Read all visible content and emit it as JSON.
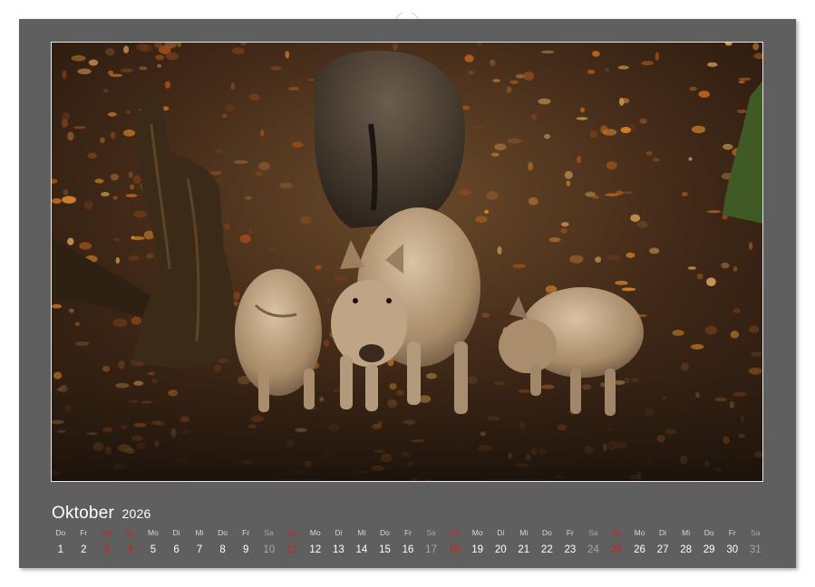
{
  "calendar": {
    "month": "Oktober",
    "year": "2026",
    "sunday_color": "#d0221f",
    "saturday_color": "#a7a7a7",
    "days": [
      {
        "dow": "Do",
        "num": "1",
        "type": "weekday"
      },
      {
        "dow": "Fr",
        "num": "2",
        "type": "weekday"
      },
      {
        "dow": "Sa",
        "num": "3",
        "type": "sunday"
      },
      {
        "dow": "So",
        "num": "4",
        "type": "sunday"
      },
      {
        "dow": "Mo",
        "num": "5",
        "type": "weekday"
      },
      {
        "dow": "Di",
        "num": "6",
        "type": "weekday"
      },
      {
        "dow": "Mi",
        "num": "7",
        "type": "weekday"
      },
      {
        "dow": "Do",
        "num": "8",
        "type": "weekday"
      },
      {
        "dow": "Fr",
        "num": "9",
        "type": "weekday"
      },
      {
        "dow": "Sa",
        "num": "10",
        "type": "saturday"
      },
      {
        "dow": "So",
        "num": "11",
        "type": "sunday"
      },
      {
        "dow": "Mo",
        "num": "12",
        "type": "weekday"
      },
      {
        "dow": "Di",
        "num": "13",
        "type": "weekday"
      },
      {
        "dow": "Mi",
        "num": "14",
        "type": "weekday"
      },
      {
        "dow": "Do",
        "num": "15",
        "type": "weekday"
      },
      {
        "dow": "Fr",
        "num": "16",
        "type": "weekday"
      },
      {
        "dow": "Sa",
        "num": "17",
        "type": "saturday"
      },
      {
        "dow": "So",
        "num": "18",
        "type": "sunday"
      },
      {
        "dow": "Mo",
        "num": "19",
        "type": "weekday"
      },
      {
        "dow": "Di",
        "num": "20",
        "type": "weekday"
      },
      {
        "dow": "Mi",
        "num": "21",
        "type": "weekday"
      },
      {
        "dow": "Do",
        "num": "22",
        "type": "weekday"
      },
      {
        "dow": "Fr",
        "num": "23",
        "type": "weekday"
      },
      {
        "dow": "Sa",
        "num": "24",
        "type": "saturday"
      },
      {
        "dow": "So",
        "num": "25",
        "type": "sunday"
      },
      {
        "dow": "Mo",
        "num": "26",
        "type": "weekday"
      },
      {
        "dow": "Di",
        "num": "27",
        "type": "weekday"
      },
      {
        "dow": "Mi",
        "num": "28",
        "type": "weekday"
      },
      {
        "dow": "Do",
        "num": "29",
        "type": "weekday"
      },
      {
        "dow": "Fr",
        "num": "30",
        "type": "weekday"
      },
      {
        "dow": "Sa",
        "num": "31",
        "type": "saturday"
      }
    ]
  },
  "photo": {
    "subject": "wild-boar-piglets-forest-photo"
  },
  "colors": {
    "sheet": "#5f5f5f",
    "paper": "#ffffff"
  }
}
